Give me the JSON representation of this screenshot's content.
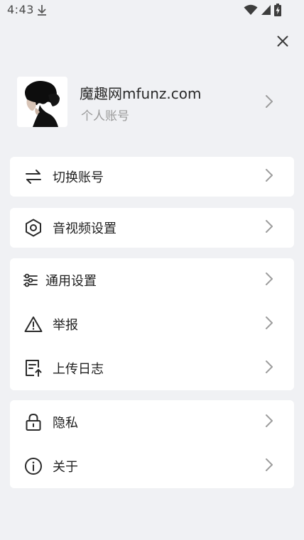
{
  "status_bar": {
    "time": "4:43",
    "icons": [
      "download-icon",
      "wifi-icon",
      "signal-icon",
      "battery-charging-icon"
    ]
  },
  "close_icon": "close-icon",
  "profile": {
    "name": "魔趣网mfunz.com",
    "subtitle": "个人账号"
  },
  "menu": {
    "switch_account": "切换账号",
    "av_settings": "音视频设置",
    "general_settings": "通用设置",
    "report": "举报",
    "upload_log": "上传日志",
    "privacy": "隐私",
    "about": "关于"
  },
  "colors": {
    "background": "#f0f1f4",
    "card": "#ffffff",
    "text": "#1f1f1f",
    "subtext": "#9a9a9a",
    "chevron": "#9c9c9c"
  }
}
